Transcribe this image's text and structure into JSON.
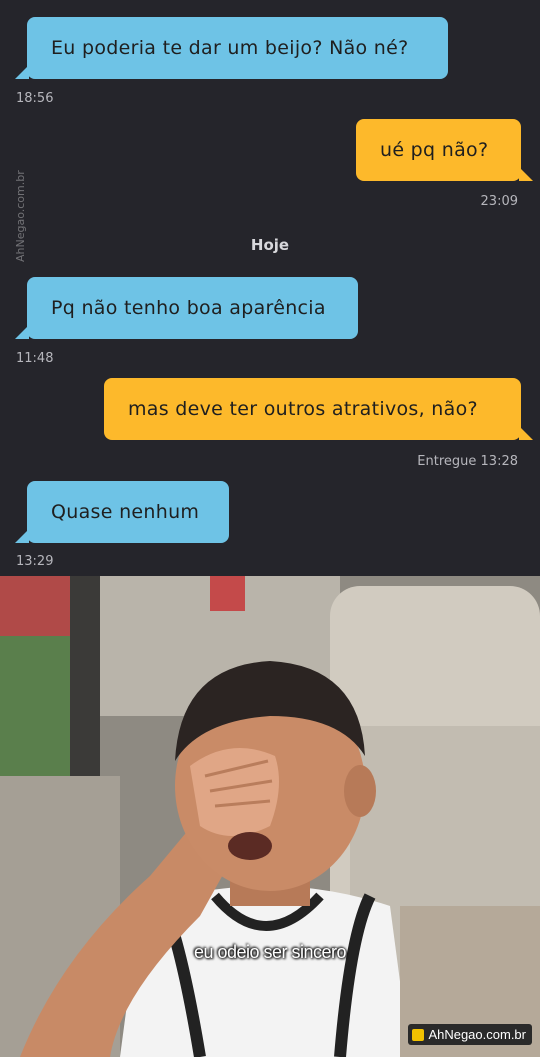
{
  "messages": [
    {
      "text": "Eu poderia te dar um beijo? Não né?",
      "time": "18:56"
    },
    {
      "text": "ué pq não?",
      "time": "23:09"
    },
    {
      "text": "Pq não tenho boa aparência",
      "time": "11:48"
    },
    {
      "text": "mas deve ter outros atrativos, não?",
      "time": "Entregue 13:28"
    },
    {
      "text": "Quase nenhum",
      "time": "13:29"
    }
  ],
  "day_label": "Hoje",
  "watermark": "AhNegao.com.br",
  "photo": {
    "caption": "eu odeio ser sincero",
    "badge": "AhNegao.com.br"
  },
  "colors": {
    "background": "#25252b",
    "incoming": "#6ec3e6",
    "outgoing": "#fdb92b"
  }
}
